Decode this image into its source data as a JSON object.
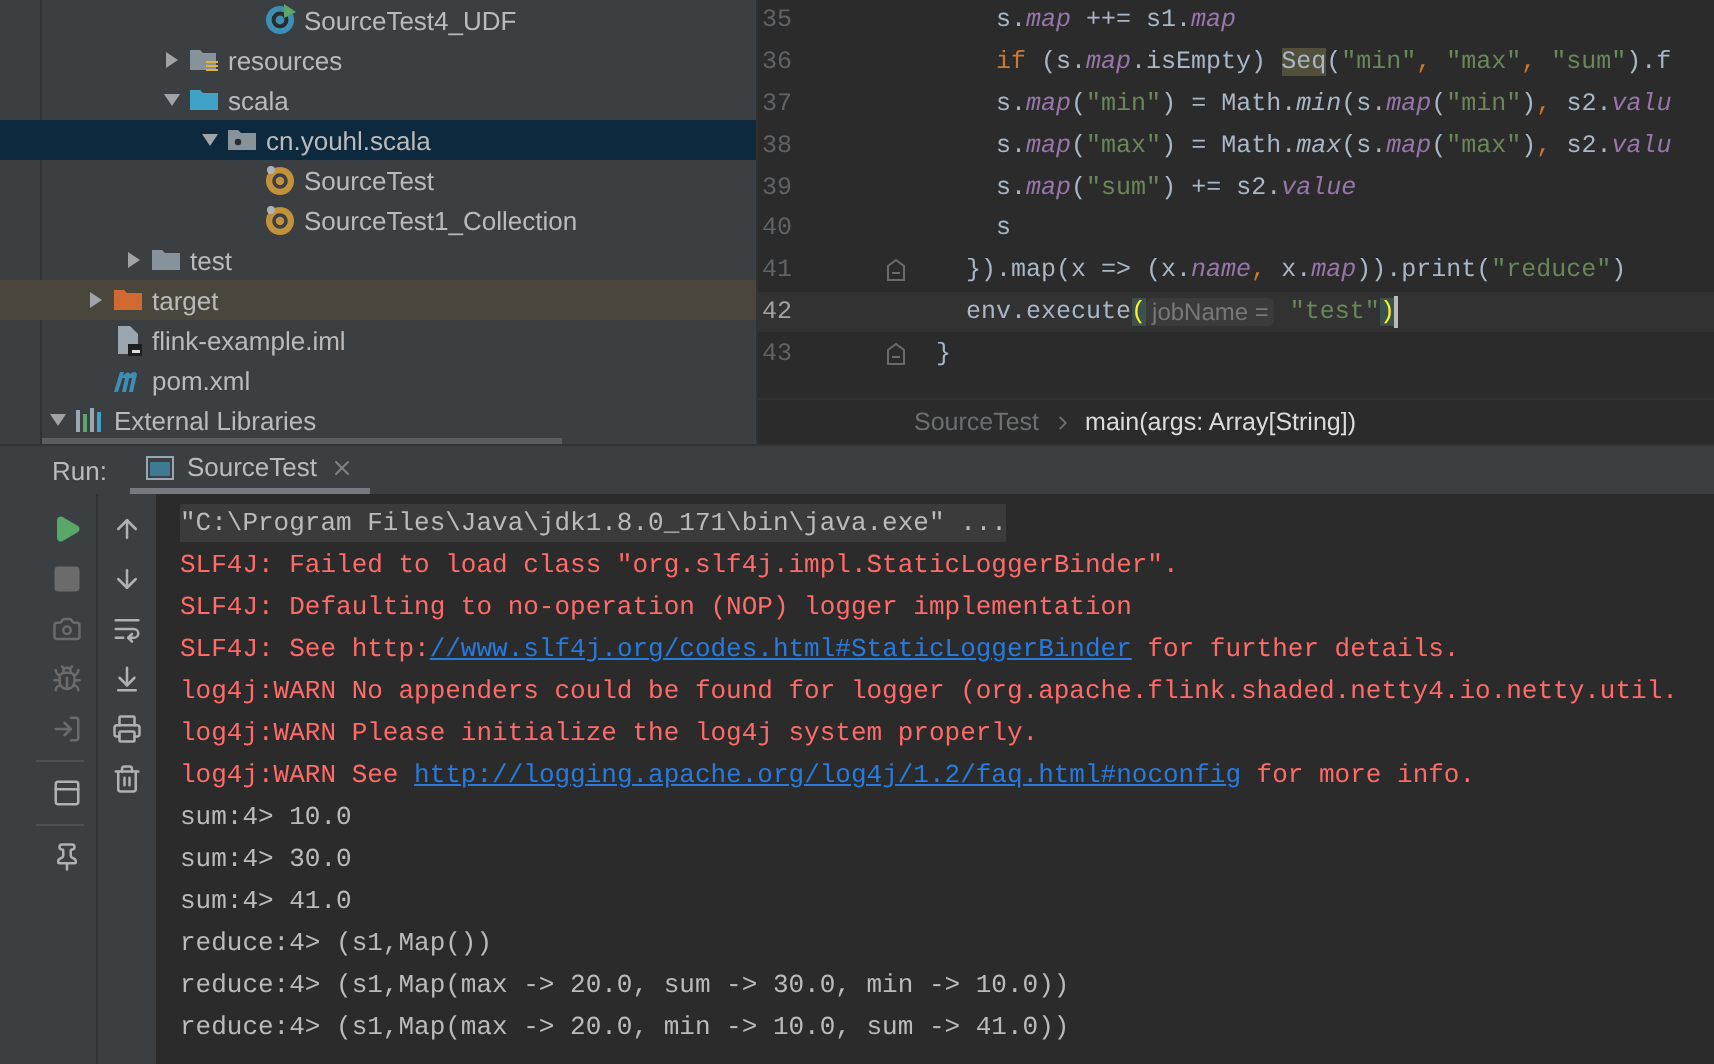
{
  "project_tree": [
    {
      "label": "SourceTest4_UDF",
      "kind": "scala-object-run"
    },
    {
      "label": "resources",
      "kind": "resources-folder",
      "expanded": false
    },
    {
      "label": "scala",
      "kind": "source-folder",
      "expanded": true,
      "children": [
        {
          "label": "cn.youhl.scala",
          "kind": "package",
          "expanded": true,
          "selected": true,
          "children": [
            {
              "label": "SourceTest",
              "kind": "scala-object"
            },
            {
              "label": "SourceTest1_Collection",
              "kind": "scala-object"
            }
          ]
        }
      ]
    },
    {
      "label": "test",
      "kind": "folder",
      "expanded": false
    },
    {
      "label": "target",
      "kind": "excluded-folder",
      "expanded": false
    },
    {
      "label": "flink-example.iml",
      "kind": "module-file"
    },
    {
      "label": "pom.xml",
      "kind": "maven-file"
    },
    {
      "label": "External Libraries",
      "kind": "libraries",
      "expanded": true
    }
  ],
  "editor": {
    "lines": [
      {
        "number": "35",
        "current": false,
        "fold_marker": false,
        "segments": [
          {
            "kind": "plain",
            "text": "      s."
          },
          {
            "kind": "field",
            "text": "map"
          },
          {
            "kind": "plain",
            "text": " ++= s1."
          },
          {
            "kind": "field",
            "text": "map"
          }
        ]
      },
      {
        "number": "36",
        "current": false,
        "fold_marker": false,
        "segments": [
          {
            "kind": "keyword",
            "text": "      if"
          },
          {
            "kind": "plain",
            "text": " (s."
          },
          {
            "kind": "field",
            "text": "map"
          },
          {
            "kind": "plain",
            "text": ".isEmpty) "
          },
          {
            "kind": "match",
            "text": "Seq"
          },
          {
            "kind": "plain",
            "text": "("
          },
          {
            "kind": "string",
            "text": "\"min\""
          },
          {
            "kind": "keyword",
            "text": ","
          },
          {
            "kind": "string",
            "text": " \"max\""
          },
          {
            "kind": "keyword",
            "text": ","
          },
          {
            "kind": "string",
            "text": " \"sum\""
          },
          {
            "kind": "plain",
            "text": ").f"
          }
        ]
      },
      {
        "number": "37",
        "current": false,
        "fold_marker": false,
        "segments": [
          {
            "kind": "plain",
            "text": "      s."
          },
          {
            "kind": "field",
            "text": "map"
          },
          {
            "kind": "plain",
            "text": "("
          },
          {
            "kind": "string",
            "text": "\"min\""
          },
          {
            "kind": "plain",
            "text": ") = Math."
          },
          {
            "kind": "static",
            "text": "min"
          },
          {
            "kind": "plain",
            "text": "(s."
          },
          {
            "kind": "field",
            "text": "map"
          },
          {
            "kind": "plain",
            "text": "("
          },
          {
            "kind": "string",
            "text": "\"min\""
          },
          {
            "kind": "plain",
            "text": ")"
          },
          {
            "kind": "keyword",
            "text": ","
          },
          {
            "kind": "plain",
            "text": " s2."
          },
          {
            "kind": "field",
            "text": "valu"
          }
        ]
      },
      {
        "number": "38",
        "current": false,
        "fold_marker": false,
        "segments": [
          {
            "kind": "plain",
            "text": "      s."
          },
          {
            "kind": "field",
            "text": "map"
          },
          {
            "kind": "plain",
            "text": "("
          },
          {
            "kind": "string",
            "text": "\"max\""
          },
          {
            "kind": "plain",
            "text": ") = Math."
          },
          {
            "kind": "static",
            "text": "max"
          },
          {
            "kind": "plain",
            "text": "(s."
          },
          {
            "kind": "field",
            "text": "map"
          },
          {
            "kind": "plain",
            "text": "("
          },
          {
            "kind": "string",
            "text": "\"max\""
          },
          {
            "kind": "plain",
            "text": ")"
          },
          {
            "kind": "keyword",
            "text": ","
          },
          {
            "kind": "plain",
            "text": " s2."
          },
          {
            "kind": "field",
            "text": "valu"
          }
        ]
      },
      {
        "number": "39",
        "current": false,
        "fold_marker": false,
        "segments": [
          {
            "kind": "plain",
            "text": "      s."
          },
          {
            "kind": "field",
            "text": "map"
          },
          {
            "kind": "plain",
            "text": "("
          },
          {
            "kind": "string",
            "text": "\"sum\""
          },
          {
            "kind": "plain",
            "text": ") += s2."
          },
          {
            "kind": "field",
            "text": "value"
          }
        ]
      },
      {
        "number": "40",
        "current": false,
        "fold_marker": false,
        "segments": [
          {
            "kind": "plain",
            "text": "      s"
          }
        ]
      },
      {
        "number": "41",
        "current": false,
        "fold_marker": true,
        "segments": [
          {
            "kind": "plain",
            "text": "    }).map(x => (x."
          },
          {
            "kind": "field",
            "text": "name"
          },
          {
            "kind": "keyword",
            "text": ","
          },
          {
            "kind": "plain",
            "text": " x."
          },
          {
            "kind": "field",
            "text": "map"
          },
          {
            "kind": "plain",
            "text": ")).print("
          },
          {
            "kind": "string",
            "text": "\"reduce\""
          },
          {
            "kind": "plain",
            "text": ")"
          }
        ]
      },
      {
        "number": "42",
        "current": true,
        "fold_marker": false,
        "segments": [
          {
            "kind": "plain",
            "text": "    env.execute"
          },
          {
            "kind": "brace",
            "text": "("
          },
          {
            "kind": "hint",
            "text": "jobName ="
          },
          {
            "kind": "string",
            "text": " \"test\""
          },
          {
            "kind": "brace",
            "text": ")"
          }
        ]
      },
      {
        "number": "43",
        "current": false,
        "fold_marker": true,
        "segments": [
          {
            "kind": "plain",
            "text": "  }"
          }
        ]
      }
    ],
    "breadcrumb": [
      {
        "label": "SourceTest",
        "selected": false
      },
      {
        "label": "main(args: Array[String])",
        "selected": true
      }
    ]
  },
  "run_panel": {
    "label": "Run:",
    "tabs": [
      {
        "label": "SourceTest",
        "selected": true
      }
    ],
    "console": [
      {
        "highlighted": true,
        "segments": [
          {
            "kind": "command",
            "text": "\"C:\\Program Files\\Java\\jdk1.8.0_171\\bin\\java.exe\" ..."
          }
        ]
      },
      {
        "highlighted": false,
        "segments": [
          {
            "kind": "error",
            "text": "SLF4J: Failed to load class \"org.slf4j.impl.StaticLoggerBinder\"."
          }
        ]
      },
      {
        "highlighted": false,
        "segments": [
          {
            "kind": "error",
            "text": "SLF4J: Defaulting to no-operation (NOP) logger implementation"
          }
        ]
      },
      {
        "highlighted": false,
        "segments": [
          {
            "kind": "error",
            "text": "SLF4J: See http:"
          },
          {
            "kind": "link",
            "text": "//www.slf4j.org/codes.html#StaticLoggerBinder"
          },
          {
            "kind": "error",
            "text": " for further details."
          }
        ]
      },
      {
        "highlighted": false,
        "segments": [
          {
            "kind": "error",
            "text": "log4j:WARN No appenders could be found for logger (org.apache.flink.shaded.netty4.io.netty.util."
          }
        ]
      },
      {
        "highlighted": false,
        "segments": [
          {
            "kind": "error",
            "text": "log4j:WARN Please initialize the log4j system properly."
          }
        ]
      },
      {
        "highlighted": false,
        "segments": [
          {
            "kind": "error",
            "text": "log4j:WARN See "
          },
          {
            "kind": "link",
            "text": "http://logging.apache.org/log4j/1.2/faq.html#noconfig"
          },
          {
            "kind": "error",
            "text": " for more info."
          }
        ]
      },
      {
        "highlighted": false,
        "segments": [
          {
            "kind": "output",
            "text": "sum:4> 10.0"
          }
        ]
      },
      {
        "highlighted": false,
        "segments": [
          {
            "kind": "output",
            "text": "sum:4> 30.0"
          }
        ]
      },
      {
        "highlighted": false,
        "segments": [
          {
            "kind": "output",
            "text": "sum:4> 41.0"
          }
        ]
      },
      {
        "highlighted": false,
        "segments": [
          {
            "kind": "output",
            "text": "reduce:4> (s1,Map())"
          }
        ]
      },
      {
        "highlighted": false,
        "segments": [
          {
            "kind": "output",
            "text": "reduce:4> (s1,Map(max -> 20.0, sum -> 30.0, min -> 10.0))"
          }
        ]
      },
      {
        "highlighted": false,
        "segments": [
          {
            "kind": "output",
            "text": "reduce:4> (s1,Map(max -> 20.0, min -> 10.0, sum -> 41.0))"
          }
        ]
      }
    ]
  }
}
